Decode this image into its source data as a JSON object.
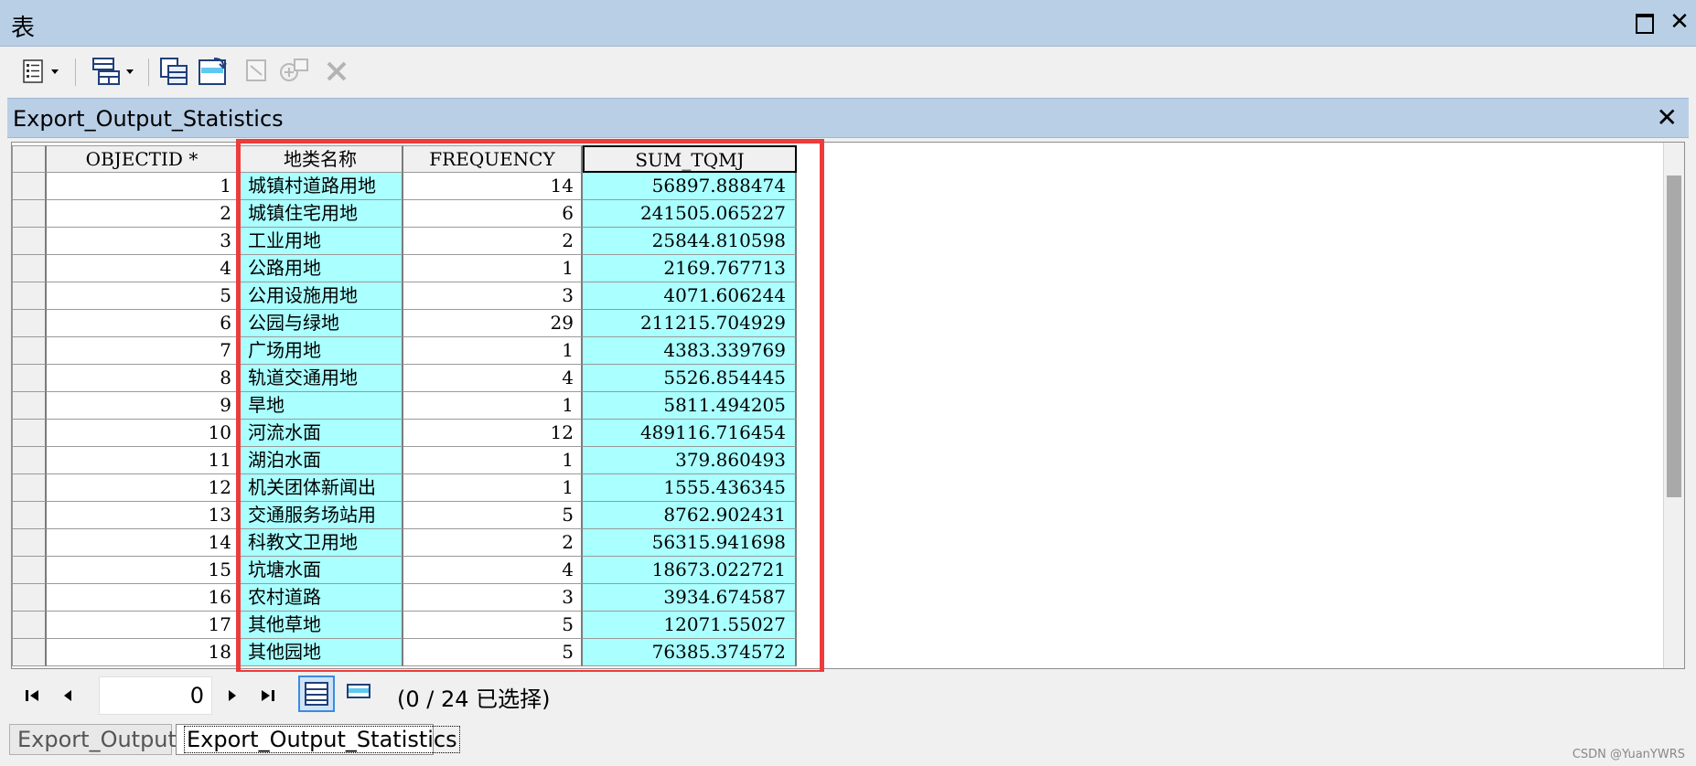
{
  "window": {
    "title": "表"
  },
  "table": {
    "title": "Export_Output_Statistics",
    "columns": [
      "OBJECTID *",
      "地类名称",
      "FREQUENCY",
      "SUM_TQMJ"
    ],
    "rows": [
      [
        "1",
        "城镇村道路用地",
        "14",
        "56897.888474"
      ],
      [
        "2",
        "城镇住宅用地",
        "6",
        "241505.065227"
      ],
      [
        "3",
        "工业用地",
        "2",
        "25844.810598"
      ],
      [
        "4",
        "公路用地",
        "1",
        "2169.767713"
      ],
      [
        "5",
        "公用设施用地",
        "3",
        "4071.606244"
      ],
      [
        "6",
        "公园与绿地",
        "29",
        "211215.704929"
      ],
      [
        "7",
        "广场用地",
        "1",
        "4383.339769"
      ],
      [
        "8",
        "轨道交通用地",
        "4",
        "5526.854445"
      ],
      [
        "9",
        "旱地",
        "1",
        "5811.494205"
      ],
      [
        "10",
        "河流水面",
        "12",
        "489116.716454"
      ],
      [
        "11",
        "湖泊水面",
        "1",
        "379.860493"
      ],
      [
        "12",
        "机关团体新闻出",
        "1",
        "1555.436345"
      ],
      [
        "13",
        "交通服务场站用",
        "5",
        "8762.902431"
      ],
      [
        "14",
        "科教文卫用地",
        "2",
        "56315.941698"
      ],
      [
        "15",
        "坑塘水面",
        "4",
        "18673.022721"
      ],
      [
        "16",
        "农村道路",
        "3",
        "3934.674587"
      ],
      [
        "17",
        "其他草地",
        "5",
        "12071.55027"
      ],
      [
        "18",
        "其他园地",
        "5",
        "76385.374572"
      ]
    ]
  },
  "nav": {
    "record": "0",
    "status": "(0 / 24 已选择)"
  },
  "tabs": [
    {
      "label": "Export_Output",
      "active": false
    },
    {
      "label": "Export_Output_Statistics",
      "active": true
    }
  ],
  "watermark": "CSDN @YuanYWRS",
  "colors": {
    "titlebar": "#b9cfe6",
    "highlight_cell": "#aaffff",
    "annotation_box": "#ee3b3b"
  },
  "icons": [
    "table-options-icon",
    "related-tables-icon",
    "select-by-attributes-icon",
    "switch-selection-icon",
    "clear-selection-icon",
    "zoom-to-selected-icon",
    "delete-selected-icon"
  ]
}
